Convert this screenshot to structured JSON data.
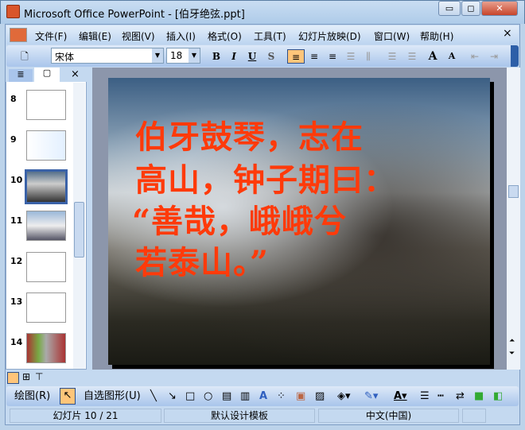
{
  "window": {
    "title": "Microsoft Office PowerPoint - [伯牙绝弦.ppt]",
    "minimize": "▭",
    "restore": "◻",
    "close": "✕"
  },
  "menu": [
    "文件(F)",
    "编辑(E)",
    "视图(V)",
    "插入(I)",
    "格式(O)",
    "工具(T)",
    "幻灯片放映(D)",
    "窗口(W)",
    "帮助(H)"
  ],
  "menu_close": "×",
  "toolbar": {
    "font": "宋体",
    "size": "18",
    "bold": "B",
    "italic": "I",
    "underline": "U",
    "shadow": "S",
    "grow": "A",
    "shrink": "A"
  },
  "panel": {
    "close": "×",
    "slides": [
      "8",
      "9",
      "10",
      "11",
      "12",
      "13",
      "14"
    ],
    "selected": "10"
  },
  "slide": {
    "lines": [
      "伯牙鼓琴，志在",
      "高山，钟子期曰：",
      "“善哉，峨峨兮",
      "若泰山。”"
    ]
  },
  "drawbar": {
    "draw": "绘图(R)",
    "autoshapes": "自选图形(U)"
  },
  "status": {
    "slide": "幻灯片 10 / 21",
    "template": "默认设计模板",
    "language": "中文(中国)"
  },
  "colors": {
    "accent": "#ffc57a",
    "slide_text": "#ff3a0a"
  }
}
